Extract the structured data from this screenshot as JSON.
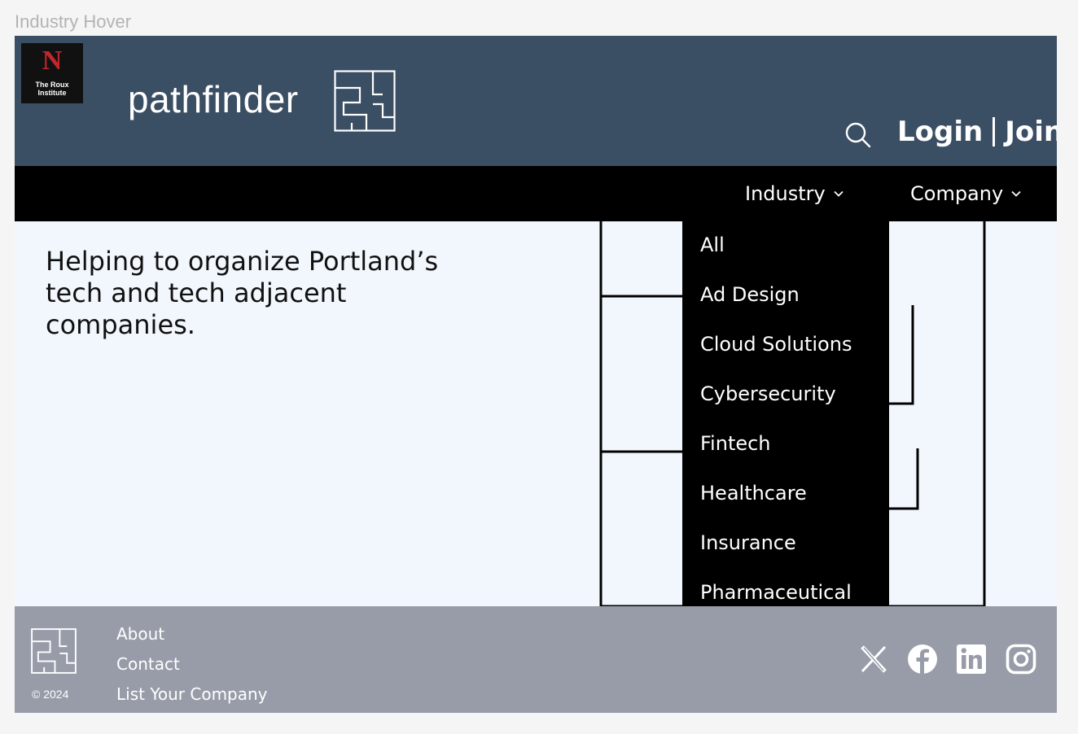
{
  "frame_label": "Industry Hover",
  "header": {
    "partner_logo": {
      "letter": "N",
      "name_line1": "The Roux",
      "name_line2": "Institute"
    },
    "brand": "pathfinder",
    "auth": {
      "login": "Login",
      "join": "Join"
    }
  },
  "nav": {
    "items": [
      {
        "label": "Industry"
      },
      {
        "label": "Company"
      }
    ]
  },
  "hero": {
    "tagline": "Helping to organize Portland’s tech and tech adjacent companies."
  },
  "industry_dropdown": {
    "options": [
      "All",
      "Ad Design",
      "Cloud Solutions",
      "Cybersecurity",
      "Fintech",
      "Healthcare",
      "Insurance",
      "Pharmaceutical"
    ]
  },
  "footer": {
    "copyright": "© 2024",
    "links": [
      "About",
      "Contact",
      "List Your Company"
    ],
    "social": [
      "x-icon",
      "facebook-icon",
      "linkedin-icon",
      "instagram-icon"
    ]
  },
  "colors": {
    "header_bg": "#3a4e64",
    "nav_bg": "#000000",
    "hero_bg": "#f2f7fd",
    "footer_bg": "#979ca8",
    "accent_red": "#c0262d"
  }
}
